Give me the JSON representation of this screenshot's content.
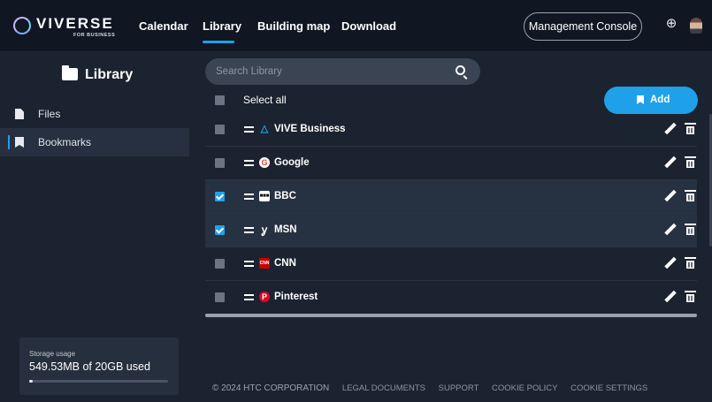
{
  "header": {
    "logo_word": "VIVERSE",
    "logo_sub": "FOR BUSINESS",
    "nav": [
      "Calendar",
      "Library",
      "Building map",
      "Download"
    ],
    "active_nav": "Library",
    "console_label": "Management Console",
    "accent": "#1ea1e8"
  },
  "sidebar": {
    "title": "Library",
    "items": [
      {
        "label": "Files",
        "icon": "file-icon"
      },
      {
        "label": "Bookmarks",
        "icon": "bookmark-icon",
        "active": true
      }
    ],
    "storage": {
      "label": "Storage usage",
      "value": "549.53MB of 20GB used",
      "fraction": 0.027
    }
  },
  "main": {
    "search_placeholder": "Search Library",
    "select_all": "Select all",
    "add_label": "Add",
    "bookmarks": [
      {
        "label": "VIVE Business",
        "icon": "vive-logo-icon",
        "checked": false
      },
      {
        "label": "Google",
        "icon": "google-logo-icon",
        "checked": false
      },
      {
        "label": "BBC",
        "icon": "bbc-logo-icon",
        "checked": true
      },
      {
        "label": "MSN",
        "icon": "msn-logo-icon",
        "checked": true
      },
      {
        "label": "CNN",
        "icon": "cnn-logo-icon",
        "checked": false
      },
      {
        "label": "Pinterest",
        "icon": "pinterest-logo-icon",
        "checked": false
      }
    ]
  },
  "footer": {
    "copyright": "© 2024 HTC CORPORATION",
    "links": [
      "LEGAL DOCUMENTS",
      "SUPPORT",
      "COOKIE POLICY",
      "COOKIE SETTINGS"
    ]
  }
}
